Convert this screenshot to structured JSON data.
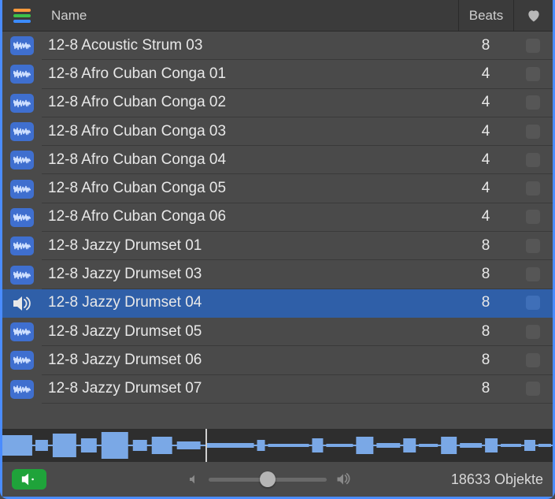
{
  "columns": {
    "name": "Name",
    "beats": "Beats"
  },
  "loops": [
    {
      "name": "12-8 Acoustic Strum 03",
      "beats": "8",
      "selected": false
    },
    {
      "name": "12-8 Afro Cuban Conga 01",
      "beats": "4",
      "selected": false
    },
    {
      "name": "12-8 Afro Cuban Conga 02",
      "beats": "4",
      "selected": false
    },
    {
      "name": "12-8 Afro Cuban Conga 03",
      "beats": "4",
      "selected": false
    },
    {
      "name": "12-8 Afro Cuban Conga 04",
      "beats": "4",
      "selected": false
    },
    {
      "name": "12-8 Afro Cuban Conga 05",
      "beats": "4",
      "selected": false
    },
    {
      "name": "12-8 Afro Cuban Conga 06",
      "beats": "4",
      "selected": false
    },
    {
      "name": "12-8 Jazzy Drumset 01",
      "beats": "8",
      "selected": false
    },
    {
      "name": "12-8 Jazzy Drumset 03",
      "beats": "8",
      "selected": false
    },
    {
      "name": "12-8 Jazzy Drumset 04",
      "beats": "8",
      "selected": true
    },
    {
      "name": "12-8 Jazzy Drumset 05",
      "beats": "8",
      "selected": false
    },
    {
      "name": "12-8 Jazzy Drumset 06",
      "beats": "8",
      "selected": false
    },
    {
      "name": "12-8 Jazzy Drumset 07",
      "beats": "8",
      "selected": false
    }
  ],
  "footer": {
    "count": "18633 Objekte"
  }
}
